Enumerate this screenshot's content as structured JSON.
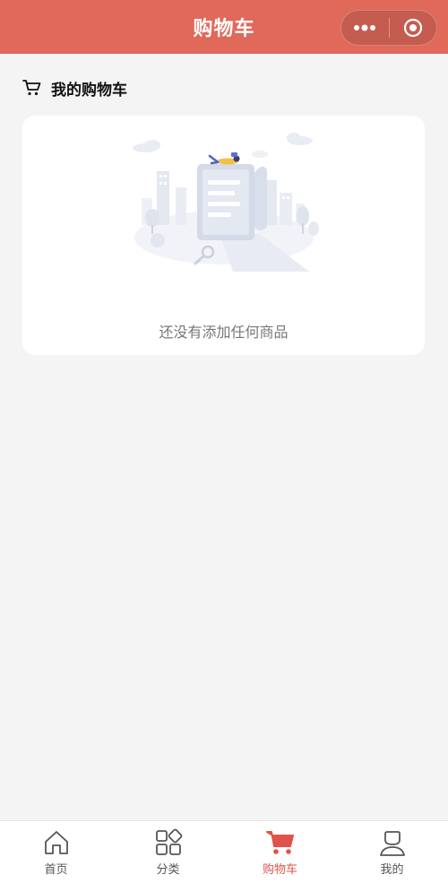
{
  "navbar": {
    "title": "购物车"
  },
  "cart": {
    "section_title": "我的购物车",
    "empty_text": "还没有添加任何商品"
  },
  "tabbar": {
    "items": [
      {
        "label": "首页",
        "icon": "home-icon",
        "active": false
      },
      {
        "label": "分类",
        "icon": "category-icon",
        "active": false
      },
      {
        "label": "购物车",
        "icon": "cart-icon",
        "active": true
      },
      {
        "label": "我的",
        "icon": "user-icon",
        "active": false
      }
    ]
  },
  "colors": {
    "brand": "#e0695a",
    "active_tab": "#e0534a",
    "page_bg": "#f4f4f4"
  }
}
